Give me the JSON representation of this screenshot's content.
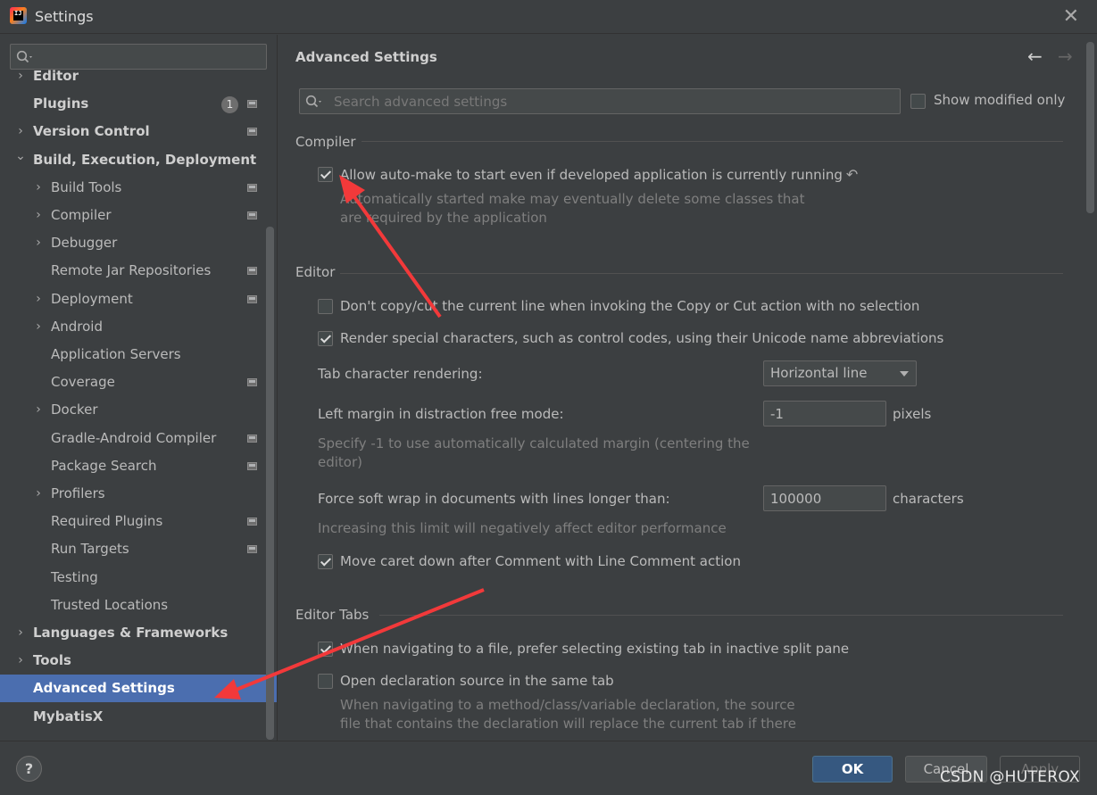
{
  "window": {
    "title": "Settings",
    "app_icon_text": "IJ"
  },
  "sidebar": {
    "search_placeholder": "",
    "items": [
      {
        "label": "Editor",
        "level": 0,
        "expandable": true,
        "bold": true,
        "badge": "",
        "project": false
      },
      {
        "label": "Plugins",
        "level": 0,
        "expandable": false,
        "bold": true,
        "badge": "1",
        "project": true
      },
      {
        "label": "Version Control",
        "level": 0,
        "expandable": true,
        "bold": true,
        "badge": "",
        "project": true
      },
      {
        "label": "Build, Execution, Deployment",
        "level": 0,
        "expandable": true,
        "expanded": true,
        "bold": true,
        "badge": "",
        "project": false
      },
      {
        "label": "Build Tools",
        "level": 1,
        "expandable": true,
        "badge": "",
        "project": true
      },
      {
        "label": "Compiler",
        "level": 1,
        "expandable": true,
        "badge": "",
        "project": true
      },
      {
        "label": "Debugger",
        "level": 1,
        "expandable": true,
        "badge": "",
        "project": false
      },
      {
        "label": "Remote Jar Repositories",
        "level": 1,
        "expandable": false,
        "badge": "",
        "project": true
      },
      {
        "label": "Deployment",
        "level": 1,
        "expandable": true,
        "badge": "",
        "project": true
      },
      {
        "label": "Android",
        "level": 1,
        "expandable": true,
        "badge": "",
        "project": false
      },
      {
        "label": "Application Servers",
        "level": 1,
        "expandable": false,
        "badge": "",
        "project": false
      },
      {
        "label": "Coverage",
        "level": 1,
        "expandable": false,
        "badge": "",
        "project": true
      },
      {
        "label": "Docker",
        "level": 1,
        "expandable": true,
        "badge": "",
        "project": false
      },
      {
        "label": "Gradle-Android Compiler",
        "level": 1,
        "expandable": false,
        "badge": "",
        "project": true
      },
      {
        "label": "Package Search",
        "level": 1,
        "expandable": false,
        "badge": "",
        "project": true
      },
      {
        "label": "Profilers",
        "level": 1,
        "expandable": true,
        "badge": "",
        "project": false
      },
      {
        "label": "Required Plugins",
        "level": 1,
        "expandable": false,
        "badge": "",
        "project": true
      },
      {
        "label": "Run Targets",
        "level": 1,
        "expandable": false,
        "badge": "",
        "project": true
      },
      {
        "label": "Testing",
        "level": 1,
        "expandable": false,
        "badge": "",
        "project": false
      },
      {
        "label": "Trusted Locations",
        "level": 1,
        "expandable": false,
        "badge": "",
        "project": false
      },
      {
        "label": "Languages & Frameworks",
        "level": 0,
        "expandable": true,
        "bold": true,
        "badge": "",
        "project": false
      },
      {
        "label": "Tools",
        "level": 0,
        "expandable": true,
        "bold": true,
        "badge": "",
        "project": false
      },
      {
        "label": "Advanced Settings",
        "level": 0,
        "expandable": false,
        "bold": true,
        "selected": true,
        "badge": "",
        "project": false
      },
      {
        "label": "MybatisX",
        "level": 0,
        "expandable": false,
        "bold": true,
        "badge": "",
        "project": false
      }
    ]
  },
  "main": {
    "title": "Advanced Settings",
    "search_placeholder": "Search advanced settings",
    "show_modified_label": "Show modified only",
    "show_modified_checked": false,
    "compiler": {
      "header": "Compiler",
      "auto_make_label": "Allow auto-make to start even if developed application is currently running",
      "auto_make_checked": true,
      "auto_make_hint_1": "Automatically started make may eventually delete some classes that",
      "auto_make_hint_2": "are required by the application"
    },
    "editor": {
      "header": "Editor",
      "no_copy_label": "Don't copy/cut the current line when invoking the Copy or Cut action with no selection",
      "no_copy_checked": false,
      "render_special_label": "Render special characters, such as control codes, using their Unicode name abbreviations",
      "render_special_checked": true,
      "tab_render_label": "Tab character rendering:",
      "tab_render_value": "Horizontal line",
      "left_margin_label": "Left margin in distraction free mode:",
      "left_margin_value": "-1",
      "left_margin_unit": "pixels",
      "left_margin_hint_1": "Specify -1 to use automatically calculated margin (centering the",
      "left_margin_hint_2": "editor)",
      "soft_wrap_label": "Force soft wrap in documents with lines longer than:",
      "soft_wrap_value": "100000",
      "soft_wrap_unit": "characters",
      "soft_wrap_hint": "Increasing this limit will negatively affect editor performance",
      "caret_down_label": "Move caret down after Comment with Line Comment action",
      "caret_down_checked": true
    },
    "editor_tabs": {
      "header": "Editor Tabs",
      "prefer_existing_label": "When navigating to a file, prefer selecting existing tab in inactive split pane",
      "prefer_existing_checked": true,
      "open_decl_label": "Open declaration source in the same tab",
      "open_decl_checked": false,
      "open_decl_hint_1": "When navigating to a method/class/variable declaration, the source",
      "open_decl_hint_2": "file that contains the declaration will replace the current tab if there"
    }
  },
  "footer": {
    "help_label": "?",
    "ok_label": "OK",
    "cancel_label": "Cancel",
    "apply_label": "Apply",
    "watermark": "CSDN @HUTEROX"
  },
  "colors": {
    "background": "#3c3f41",
    "selection": "#4b6eaf",
    "ok_button": "#365880",
    "annotation_arrow": "#f2393a"
  }
}
